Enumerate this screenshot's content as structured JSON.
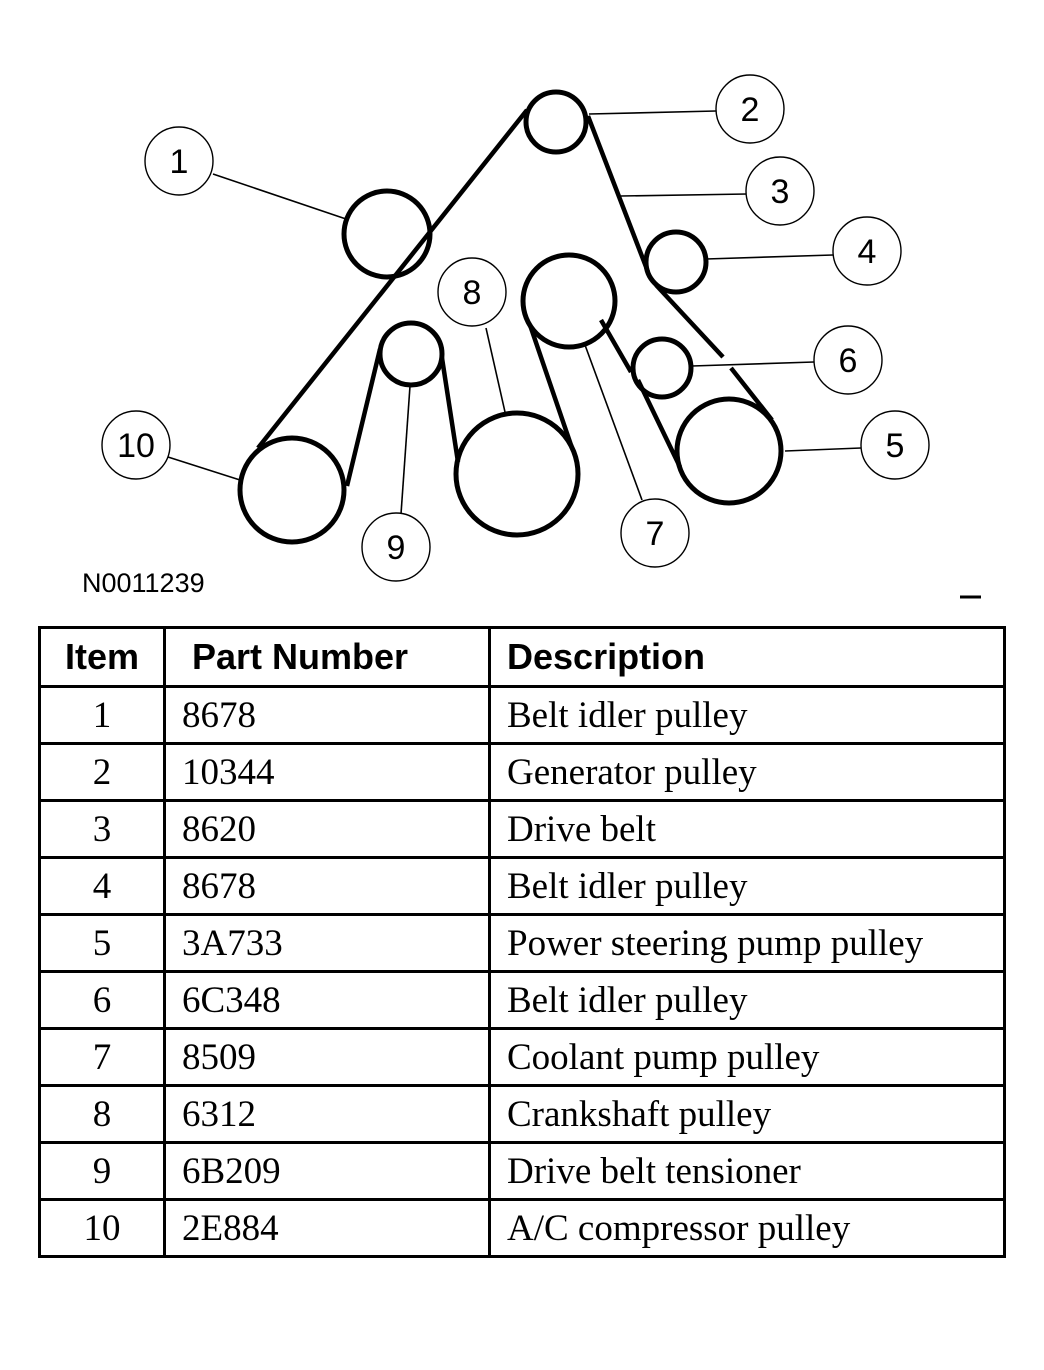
{
  "figure": {
    "id_label": "N0011239",
    "callouts": [
      "1",
      "2",
      "3",
      "4",
      "5",
      "6",
      "7",
      "8",
      "9",
      "10"
    ]
  },
  "table": {
    "headers": {
      "item": "Item",
      "part_number": "Part Number",
      "description": "Description"
    },
    "rows": [
      {
        "item": "1",
        "part_number": "8678",
        "description": "Belt idler pulley"
      },
      {
        "item": "2",
        "part_number": "10344",
        "description": "Generator pulley"
      },
      {
        "item": "3",
        "part_number": "8620",
        "description": "Drive belt"
      },
      {
        "item": "4",
        "part_number": "8678",
        "description": "Belt idler pulley"
      },
      {
        "item": "5",
        "part_number": "3A733",
        "description": "Power steering pump pulley"
      },
      {
        "item": "6",
        "part_number": "6C348",
        "description": "Belt idler pulley"
      },
      {
        "item": "7",
        "part_number": "8509",
        "description": "Coolant pump pulley"
      },
      {
        "item": "8",
        "part_number": "6312",
        "description": "Crankshaft pulley"
      },
      {
        "item": "9",
        "part_number": "6B209",
        "description": "Drive belt tensioner"
      },
      {
        "item": "10",
        "part_number": "2E884",
        "description": "A/C compressor pulley"
      }
    ]
  }
}
